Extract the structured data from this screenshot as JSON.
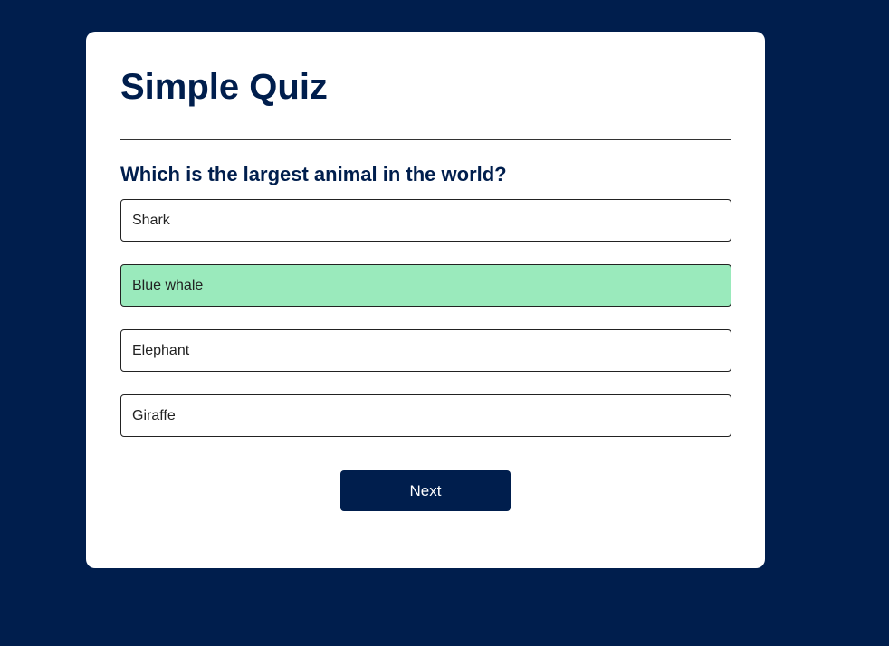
{
  "app": {
    "title": "Simple Quiz"
  },
  "quiz": {
    "question": "Which is the largest animal in the world?",
    "answers": [
      {
        "label": "Shark",
        "state": "default"
      },
      {
        "label": "Blue whale",
        "state": "correct"
      },
      {
        "label": "Elephant",
        "state": "default"
      },
      {
        "label": "Giraffe",
        "state": "default"
      }
    ],
    "next_label": "Next"
  },
  "colors": {
    "background": "#001e4d",
    "card": "#ffffff",
    "primary": "#001e4d",
    "correct": "#9aeabc"
  }
}
